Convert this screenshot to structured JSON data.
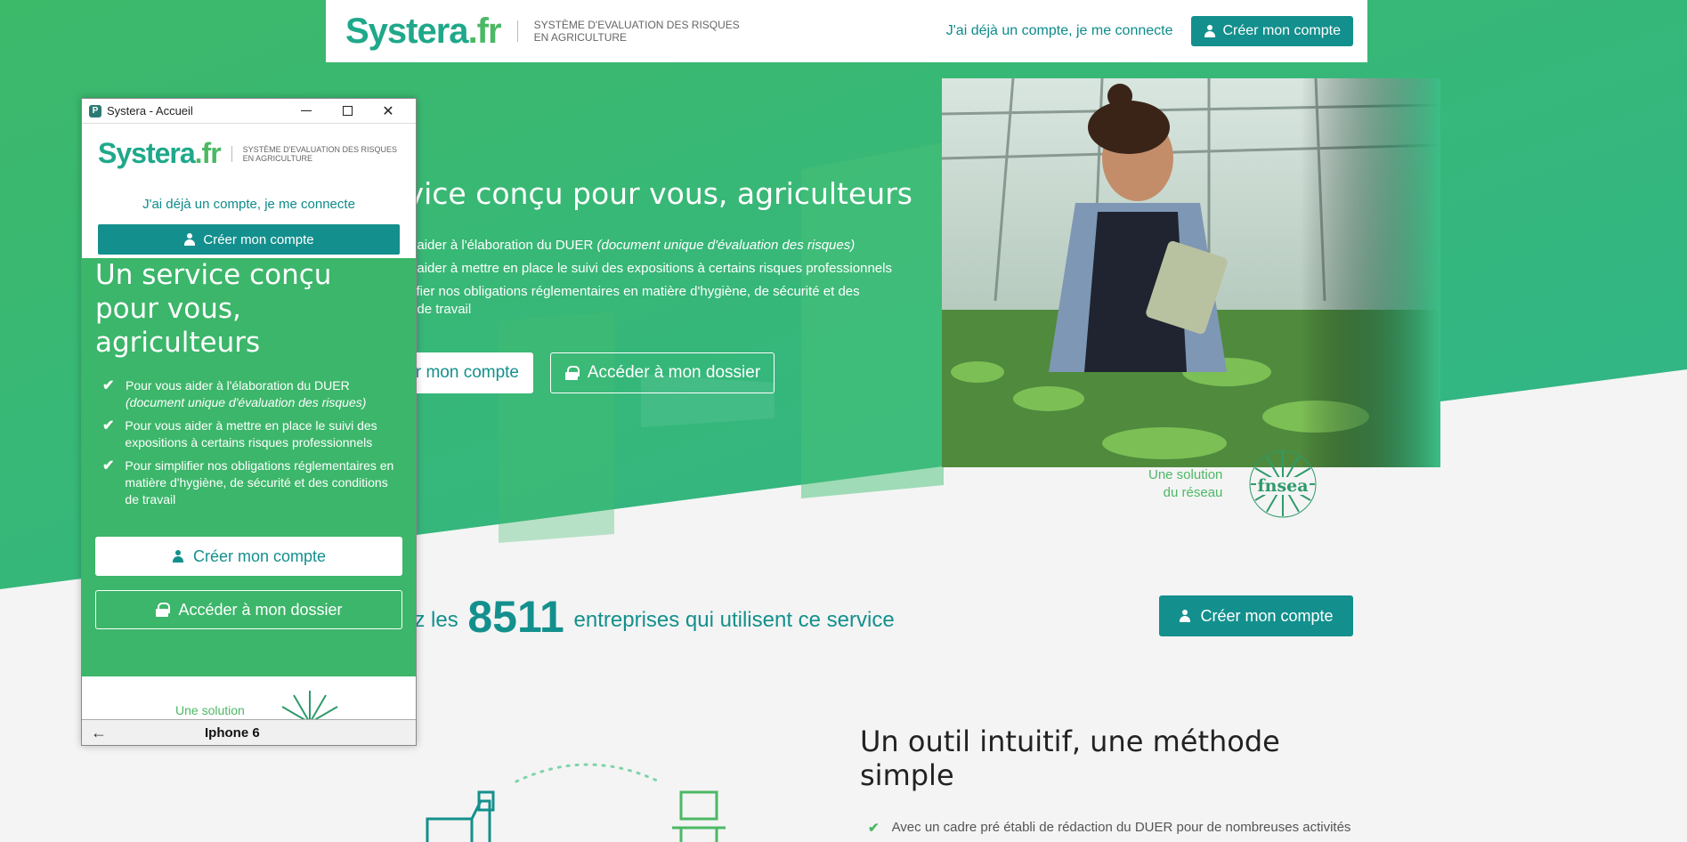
{
  "site": {
    "logo": {
      "part1": "Systera",
      "part2": ".fr",
      "tagline_line1": "Système d'evaluation des risques",
      "tagline_line2": "en agriculture"
    },
    "header": {
      "login_link": "J'ai déjà un compte, je me connecte",
      "create_account": "Créer mon compte"
    },
    "hero": {
      "title": "rvice conçu pour vous, agriculteurs",
      "list": [
        {
          "text": "ous aider à l'élaboration du DUER ",
          "italic": "(document unique d'évaluation des risques)"
        },
        {
          "text": "ous aider à mettre en place le suivi des expositions à certains risques professionnels",
          "italic": ""
        },
        {
          "text": "mplifier nos obligations réglementaires en matière d'hygiène, de sécurité et des",
          "italic": ""
        },
        {
          "text": "ons de travail",
          "italic": ""
        }
      ],
      "btn_create_partial": "r mon compte",
      "btn_access": "Accéder à mon dossier"
    },
    "fnsea": {
      "line1": "Une solution",
      "line2": "du réseau",
      "logo_text": "fnsea"
    },
    "counter": {
      "prefix": "ez les",
      "number": "8511",
      "suffix": "entreprises qui utilisent ce service"
    },
    "cta_create": "Créer mon compte",
    "tool": {
      "title": "Un outil intuitif, une méthode simple",
      "item1": "Avec un cadre pré établi de rédaction du DUER pour de nombreuses activités"
    },
    "colors": {
      "teal": "#13908d",
      "green": "#3cb66a",
      "light_green": "#4cb865"
    }
  },
  "window": {
    "title": "Systera - Accueil",
    "app_icon": "P",
    "device_label": "Iphone 6",
    "back": "←"
  },
  "phone": {
    "login_link": "J'ai déjà un compte, je me connecte",
    "create_account": "Créer mon compte",
    "title": "Un service conçu pour vous, agriculteurs",
    "list": [
      {
        "text": "Pour vous aider à l'élaboration du DUER",
        "italic": "(document unique d'évaluation des risques)"
      },
      {
        "text": "Pour vous aider à mettre en place le suivi des expositions à certains risques professionnels",
        "italic": ""
      },
      {
        "text": "Pour simplifier nos obligations réglementaires en matière d'hygiène, de sécurité et des conditions de travail",
        "italic": ""
      }
    ],
    "btn_create": "Créer mon compte",
    "btn_access": "Accéder à mon dossier",
    "footer_solution": "Une solution"
  }
}
